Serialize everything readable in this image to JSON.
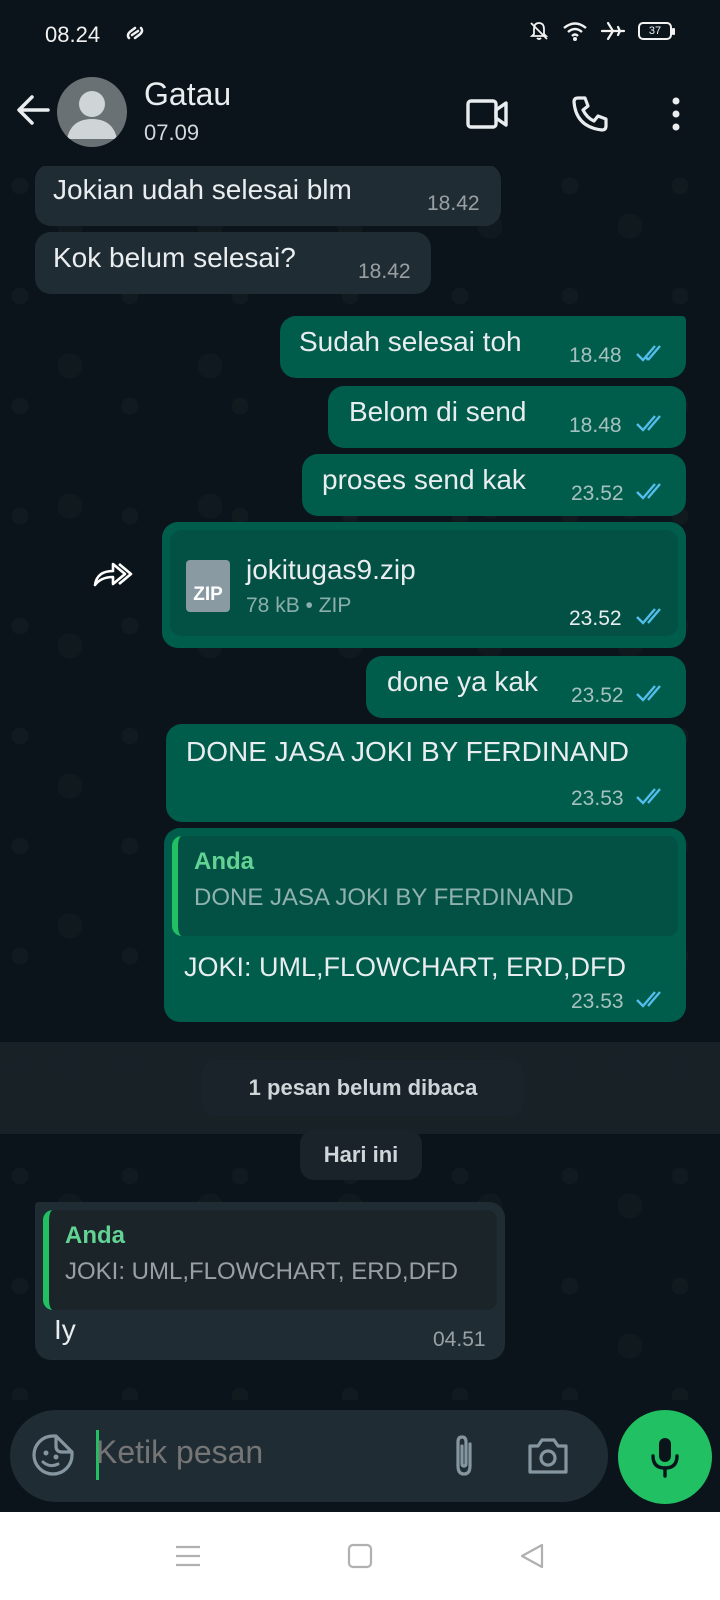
{
  "status": {
    "time": "08.24",
    "battery": "37"
  },
  "header": {
    "name": "Gatau",
    "subtitle": "07.09"
  },
  "messages": [
    {
      "dir": "in",
      "text": "Jokian udah selesai blm",
      "time": "18.42"
    },
    {
      "dir": "in",
      "text": "Kok belum selesai?",
      "time": "18.42"
    },
    {
      "dir": "out",
      "text": "Sudah selesai toh",
      "time": "18.48"
    },
    {
      "dir": "out",
      "text": "Belom di send",
      "time": "18.48"
    },
    {
      "dir": "out",
      "text": "proses send kak",
      "time": "23.52"
    },
    {
      "dir": "out",
      "file_name": "jokitugas9.zip",
      "file_meta": "78 kB • ZIP",
      "file_badge": "ZIP",
      "time": "23.52"
    },
    {
      "dir": "out",
      "text": "done ya kak",
      "time": "23.52"
    },
    {
      "dir": "out",
      "text": "DONE JASA JOKI BY FERDINAND",
      "time": "23.53"
    },
    {
      "dir": "out",
      "quote_author": "Anda",
      "quote_text": "DONE JASA JOKI BY FERDINAND",
      "text": "JOKI: UML,FLOWCHART, ERD,DFD",
      "time": "23.53"
    },
    {
      "dir": "in",
      "quote_author": "Anda",
      "quote_text": "JOKI: UML,FLOWCHART, ERD,DFD",
      "text": "Iy",
      "time": "04.51"
    }
  ],
  "unread_label": "1 pesan belum dibaca",
  "date_label": "Hari ini",
  "composer": {
    "placeholder": "Ketik pesan"
  },
  "colors": {
    "accent": "#21c063",
    "outgoing": "#005c4b",
    "incoming": "#202c33",
    "tick": "#53bdeb"
  }
}
